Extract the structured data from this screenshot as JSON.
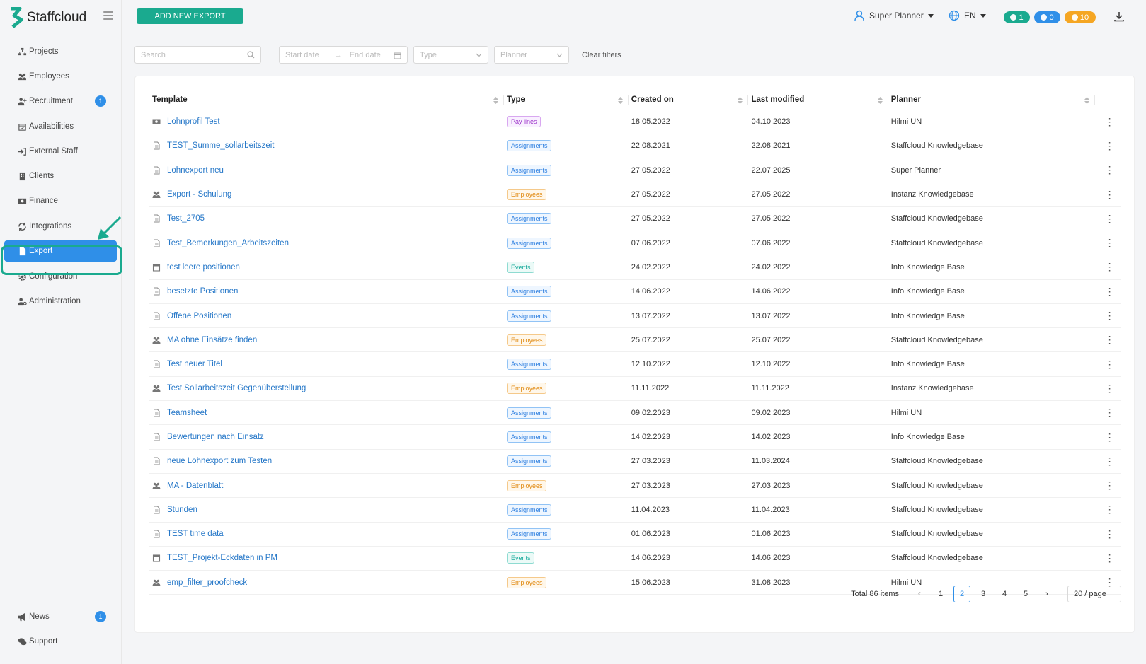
{
  "app": {
    "name": "Staffcloud"
  },
  "sidebar": {
    "items": [
      {
        "label": "Projects",
        "icon": "sitemap-icon"
      },
      {
        "label": "Employees",
        "icon": "users-icon"
      },
      {
        "label": "Recruitment",
        "icon": "user-plus-icon",
        "badge": "1"
      },
      {
        "label": "Availabilities",
        "icon": "calendar-check-icon"
      },
      {
        "label": "External Staff",
        "icon": "sign-in-icon"
      },
      {
        "label": "Clients",
        "icon": "building-icon"
      },
      {
        "label": "Finance",
        "icon": "money-icon"
      },
      {
        "label": "Integrations",
        "icon": "sync-icon"
      },
      {
        "label": "Export",
        "icon": "file-icon",
        "active": true
      },
      {
        "label": "Configuration",
        "icon": "gear-icon"
      },
      {
        "label": "Administration",
        "icon": "user-cog-icon"
      }
    ],
    "bottom": [
      {
        "label": "News",
        "icon": "megaphone-icon",
        "badge": "1"
      },
      {
        "label": "Support",
        "icon": "comments-icon"
      }
    ]
  },
  "header": {
    "add_button": "ADD NEW EXPORT",
    "user": "Super Planner",
    "language": "EN",
    "counters": [
      {
        "value": "1",
        "color": "#1aaa8f"
      },
      {
        "value": "0",
        "color": "#2f8fe8"
      },
      {
        "value": "10",
        "color": "#f5a623"
      }
    ]
  },
  "filters": {
    "search_placeholder": "Search",
    "start_date": "Start date",
    "end_date": "End date",
    "type": "Type",
    "planner": "Planner",
    "clear": "Clear filters"
  },
  "table": {
    "columns": [
      "Template",
      "Type",
      "Created on",
      "Last modified",
      "Planner"
    ],
    "rows": [
      {
        "template": "Lohnprofil Test",
        "icon": "money-icon",
        "type": "Pay lines",
        "created": "18.05.2022",
        "modified": "04.10.2023",
        "planner": "Hilmi UN"
      },
      {
        "template": "TEST_Summe_sollarbeitszeit",
        "icon": "file-icon",
        "type": "Assignments",
        "created": "22.08.2021",
        "modified": "22.08.2021",
        "planner": "Staffcloud Knowledgebase"
      },
      {
        "template": "Lohnexport neu",
        "icon": "file-icon",
        "type": "Assignments",
        "created": "27.05.2022",
        "modified": "22.07.2025",
        "planner": "Super Planner"
      },
      {
        "template": "Export - Schulung",
        "icon": "users-icon",
        "type": "Employees",
        "created": "27.05.2022",
        "modified": "27.05.2022",
        "planner": "Instanz Knowledgebase"
      },
      {
        "template": "Test_2705",
        "icon": "file-icon",
        "type": "Assignments",
        "created": "27.05.2022",
        "modified": "27.05.2022",
        "planner": "Staffcloud Knowledgebase"
      },
      {
        "template": "Test_Bemerkungen_Arbeitszeiten",
        "icon": "file-icon",
        "type": "Assignments",
        "created": "07.06.2022",
        "modified": "07.06.2022",
        "planner": "Staffcloud Knowledgebase"
      },
      {
        "template": "test leere positionen",
        "icon": "calendar-icon",
        "type": "Events",
        "created": "24.02.2022",
        "modified": "24.02.2022",
        "planner": "Info Knowledge Base"
      },
      {
        "template": "besetzte Positionen",
        "icon": "file-icon",
        "type": "Assignments",
        "created": "14.06.2022",
        "modified": "14.06.2022",
        "planner": "Info Knowledge Base"
      },
      {
        "template": "Offene Positionen",
        "icon": "file-icon",
        "type": "Assignments",
        "created": "13.07.2022",
        "modified": "13.07.2022",
        "planner": "Info Knowledge Base"
      },
      {
        "template": "MA ohne Einsätze finden",
        "icon": "users-icon",
        "type": "Employees",
        "created": "25.07.2022",
        "modified": "25.07.2022",
        "planner": "Staffcloud Knowledgebase"
      },
      {
        "template": "Test neuer Titel",
        "icon": "file-icon",
        "type": "Assignments",
        "created": "12.10.2022",
        "modified": "12.10.2022",
        "planner": "Info Knowledge Base"
      },
      {
        "template": "Test Sollarbeitszeit Gegenüberstellung",
        "icon": "users-icon",
        "type": "Employees",
        "created": "11.11.2022",
        "modified": "11.11.2022",
        "planner": "Instanz Knowledgebase"
      },
      {
        "template": "Teamsheet",
        "icon": "file-icon",
        "type": "Assignments",
        "created": "09.02.2023",
        "modified": "09.02.2023",
        "planner": "Hilmi UN"
      },
      {
        "template": "Bewertungen nach Einsatz",
        "icon": "file-icon",
        "type": "Assignments",
        "created": "14.02.2023",
        "modified": "14.02.2023",
        "planner": "Info Knowledge Base"
      },
      {
        "template": "neue Lohnexport zum Testen",
        "icon": "file-icon",
        "type": "Assignments",
        "created": "27.03.2023",
        "modified": "11.03.2024",
        "planner": "Staffcloud Knowledgebase"
      },
      {
        "template": "MA - Datenblatt",
        "icon": "users-icon",
        "type": "Employees",
        "created": "27.03.2023",
        "modified": "27.03.2023",
        "planner": "Staffcloud Knowledgebase"
      },
      {
        "template": "Stunden",
        "icon": "file-icon",
        "type": "Assignments",
        "created": "11.04.2023",
        "modified": "11.04.2023",
        "planner": "Staffcloud Knowledgebase"
      },
      {
        "template": "TEST time data",
        "icon": "file-icon",
        "type": "Assignments",
        "created": "01.06.2023",
        "modified": "01.06.2023",
        "planner": "Staffcloud Knowledgebase"
      },
      {
        "template": "TEST_Projekt-Eckdaten in PM",
        "icon": "calendar-icon",
        "type": "Events",
        "created": "14.06.2023",
        "modified": "14.06.2023",
        "planner": "Staffcloud Knowledgebase"
      },
      {
        "template": "emp_filter_proofcheck",
        "icon": "users-icon",
        "type": "Employees",
        "created": "15.06.2023",
        "modified": "31.08.2023",
        "planner": "Hilmi UN"
      }
    ]
  },
  "pagination": {
    "total": "Total 86 items",
    "pages": [
      "1",
      "2",
      "3",
      "4",
      "5"
    ],
    "current": "2",
    "per_page": "20 / page"
  }
}
